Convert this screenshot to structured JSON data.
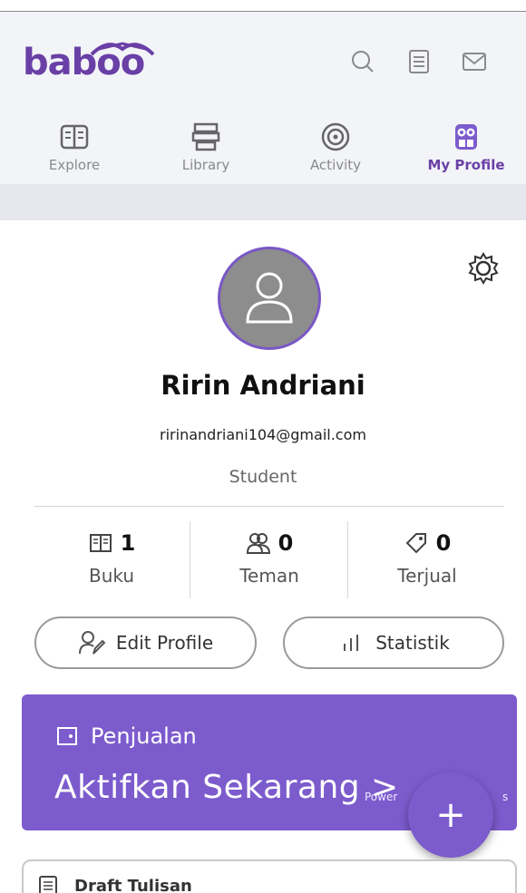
{
  "app": {
    "logo": "baboo"
  },
  "nav": {
    "items": [
      {
        "label": "Explore",
        "icon": "book-open-icon"
      },
      {
        "label": "Library",
        "icon": "library-icon"
      },
      {
        "label": "Activity",
        "icon": "activity-target-icon"
      },
      {
        "label": "My Profile",
        "icon": "owl-profile-icon"
      }
    ],
    "active": "My Profile"
  },
  "top_icons": [
    "search-icon",
    "list-icon",
    "mail-icon"
  ],
  "profile": {
    "name": "Ririn Andriani",
    "email": "ririnandriani104@gmail.com",
    "role": "Student"
  },
  "stats": [
    {
      "value": "1",
      "label": "Buku",
      "icon": "book-icon"
    },
    {
      "value": "0",
      "label": "Teman",
      "icon": "friends-icon"
    },
    {
      "value": "0",
      "label": "Terjual",
      "icon": "tag-icon"
    }
  ],
  "actions": {
    "edit_profile": "Edit Profile",
    "statistik": "Statistik"
  },
  "banner": {
    "title": "Penjualan",
    "cta": "Aktifkan Sekarang >",
    "powered_left": "Power",
    "powered_right": "s"
  },
  "fab": {
    "label": "+"
  },
  "draft": {
    "title": "Draft Tulisan"
  },
  "colors": {
    "brand": "#6a3fa6",
    "banner": "#7c5bcd",
    "header_bg": "#f2f4f8"
  }
}
